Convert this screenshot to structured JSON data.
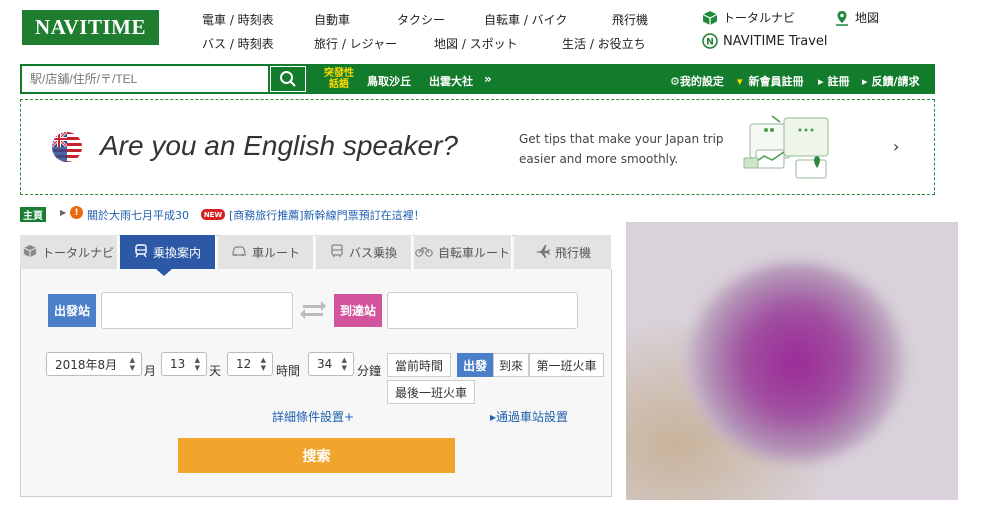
{
  "header": {
    "logo": "NAVITIME",
    "nav_row1": [
      "電車 / 時刻表",
      "自動車",
      "タクシー",
      "自転車 / バイク",
      "飛行機"
    ],
    "nav_row2": [
      "バス / 時刻表",
      "旅行 / レジャー",
      "地図 / スポット",
      "生活 / お役立ち"
    ],
    "total_navi": "トータルナビ",
    "map": "地図",
    "travel": "NAVITIME Travel"
  },
  "searchbar": {
    "placeholder": "駅/店舖/住所/〒/TEL",
    "breaking_label": "突發性話語",
    "topics": [
      "鳥取沙丘",
      "出雲大社"
    ],
    "more": "»",
    "right_links": [
      "我的設定",
      "新會員註冊",
      "註冊",
      "反饋/請求"
    ]
  },
  "banner": {
    "title": "Are you an English speaker?",
    "desc": "Get tips that make your Japan trip easier and more smoothly.",
    "arrow": "›"
  },
  "news": {
    "badge": "主頁",
    "item1": "關於大雨七月平成30",
    "new_tag": "NEW",
    "item2": "[商務旅行推薦]新幹線門票預訂在這裡！"
  },
  "route": {
    "tabs": [
      "トータルナビ",
      "乗換案内",
      "車ルート",
      "バス乗換",
      "自転車ルート",
      "飛行機"
    ],
    "active_tab": "乗換案内",
    "from_label": "出發站",
    "to_label": "到達站",
    "from_value": "",
    "to_value": "",
    "month": "2018年8月",
    "month_unit": "月",
    "day": "13",
    "day_unit": "天",
    "hour": "12",
    "hour_unit": "時間",
    "minute": "34",
    "minute_unit": "分鐘",
    "buttons": [
      "當前時間",
      "出發",
      "到來",
      "第一班火車",
      "最後一班火車"
    ],
    "selected_button": "出發",
    "detail_link": "詳細條件設置+",
    "via_link": "▸通過車站設置",
    "search_button": "搜索"
  },
  "colors": {
    "brand_green": "#137c2c",
    "active_tab": "#2c58a6",
    "from_label": "#4b7fc9",
    "to_label": "#d2549c",
    "search_button": "#f1a52c"
  }
}
